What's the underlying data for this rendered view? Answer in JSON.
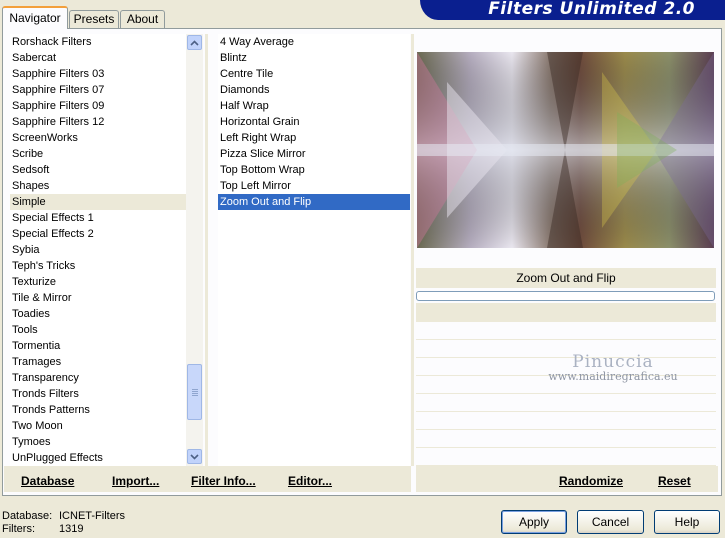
{
  "header": {
    "title": "Filters Unlimited 2.0"
  },
  "tabs": [
    {
      "label": "Navigator",
      "active": true
    },
    {
      "label": "Presets",
      "active": false
    },
    {
      "label": "About",
      "active": false
    }
  ],
  "categories": [
    "Rorshack Filters",
    "Sabercat",
    "Sapphire Filters 03",
    "Sapphire Filters 07",
    "Sapphire Filters 09",
    "Sapphire Filters 12",
    "ScreenWorks",
    "Scribe",
    "Sedsoft",
    "Shapes",
    "Simple",
    "Special Effects 1",
    "Special Effects 2",
    "Sybia",
    "Teph's Tricks",
    "Texturize",
    "Tile & Mirror",
    "Toadies",
    "Tools",
    "Tormentia",
    "Tramages",
    "Transparency",
    "Tronds Filters",
    "Tronds Patterns",
    "Two Moon",
    "Tymoes",
    "UnPlugged Effects"
  ],
  "selected_category": "Simple",
  "filters": [
    "4 Way Average",
    "Blintz",
    "Centre Tile",
    "Diamonds",
    "Half Wrap",
    "Horizontal Grain",
    "Left Right Wrap",
    "Pizza Slice Mirror",
    "Top Bottom Wrap",
    "Top Left Mirror",
    "Zoom Out and Flip"
  ],
  "selected_filter": "Zoom Out and Flip",
  "preview": {
    "filter_name": "Zoom Out and Flip"
  },
  "watermark": {
    "name": "Pinuccia",
    "url": "www.maidiregrafica.eu"
  },
  "bottom_links": {
    "database": "Database",
    "import": "Import...",
    "filter_info": "Filter Info...",
    "editor": "Editor...",
    "randomize": "Randomize",
    "reset": "Reset"
  },
  "status": {
    "database_label": "Database:",
    "database_value": "ICNET-Filters",
    "filters_label": "Filters:",
    "filters_value": "1319"
  },
  "buttons": {
    "apply": "Apply",
    "cancel": "Cancel",
    "help": "Help"
  },
  "colors": {
    "banner": "#0a1f8f",
    "selection": "#316ac5",
    "tab_accent": "#f3a03b"
  }
}
